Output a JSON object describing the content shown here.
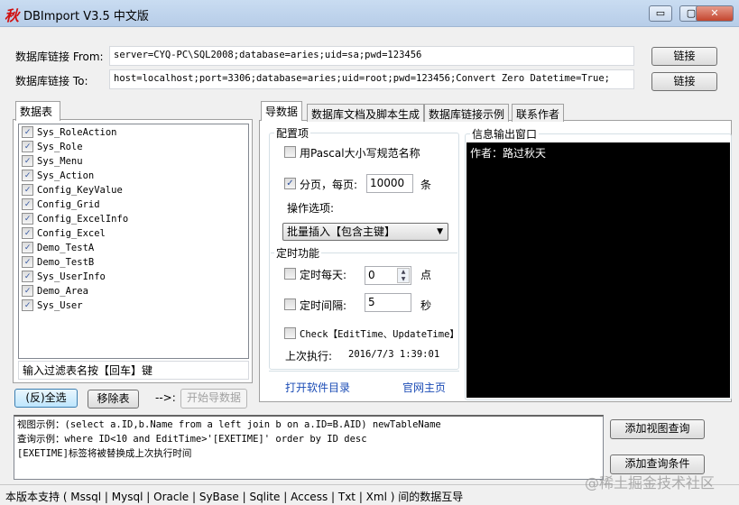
{
  "window": {
    "logo": "秋",
    "title": "DBImport V3.5 中文版",
    "minimize": "▭",
    "maximize": "▢",
    "close": "✕"
  },
  "connection": {
    "from_label": "数据库链接 From:",
    "from_value": "server=CYQ-PC\\SQL2008;database=aries;uid=sa;pwd=123456",
    "from_button": "链接",
    "to_label": "数据库链接 To:",
    "to_value": "host=localhost;port=3306;database=aries;uid=root;pwd=123456;Convert Zero Datetime=True;",
    "to_button": "链接"
  },
  "tables": {
    "tab_label": "数据表",
    "items": [
      "Sys_RoleAction",
      "Sys_Role",
      "Sys_Menu",
      "Sys_Action",
      "Config_KeyValue",
      "Config_Grid",
      "Config_ExcelInfo",
      "Config_Excel",
      "Demo_TestA",
      "Demo_TestB",
      "Sys_UserInfo",
      "Demo_Area",
      "Sys_User"
    ],
    "filter_placeholder": "输入过滤表名按【回车】键"
  },
  "actions": {
    "select_all": "(反)全选",
    "remove": "移除表",
    "arrow": "-->:",
    "start": "开始导数据"
  },
  "tabs": [
    "导数据",
    "数据库文档及脚本生成",
    "数据库链接示例",
    "联系作者"
  ],
  "config": {
    "group_label": "配置项",
    "pascal": "用Pascal大小写规范名称",
    "paging": "分页，每页:",
    "page_size": "10000",
    "page_unit": "条",
    "op_label": "操作选项:",
    "op_value": "批量插入【包含主键】"
  },
  "timer": {
    "group_label": "定时功能",
    "daily": "定时每天:",
    "daily_value": "0",
    "daily_unit": "点",
    "interval": "定时间隔:",
    "interval_value": "5",
    "interval_unit": "秒",
    "check": "Check【EditTime、UpdateTime】",
    "last_label": "上次执行:",
    "last_value": "2016/7/3 1:39:01"
  },
  "links": {
    "open_dir": "打开软件目录",
    "homepage": "官网主页"
  },
  "info": {
    "label": "信息输出窗口",
    "text": "作者：路过秋天"
  },
  "query": {
    "lines": [
      "视图示例：(select a.ID,b.Name from a left join b on a.ID=B.AID) newTableName",
      "查询示例：where ID<10 and EditTime>'[EXETIME]' order by ID desc",
      "[EXETIME]标签将被替换成上次执行时间"
    ],
    "add_view": "添加视图查询",
    "add_condition": "添加查询条件"
  },
  "watermark": "@稀土掘金技术社区",
  "status": "本版本支持 ( Mssql | Mysql | Oracle | SyBase | Sqlite | Access | Txt | Xml ) 间的数据互导"
}
